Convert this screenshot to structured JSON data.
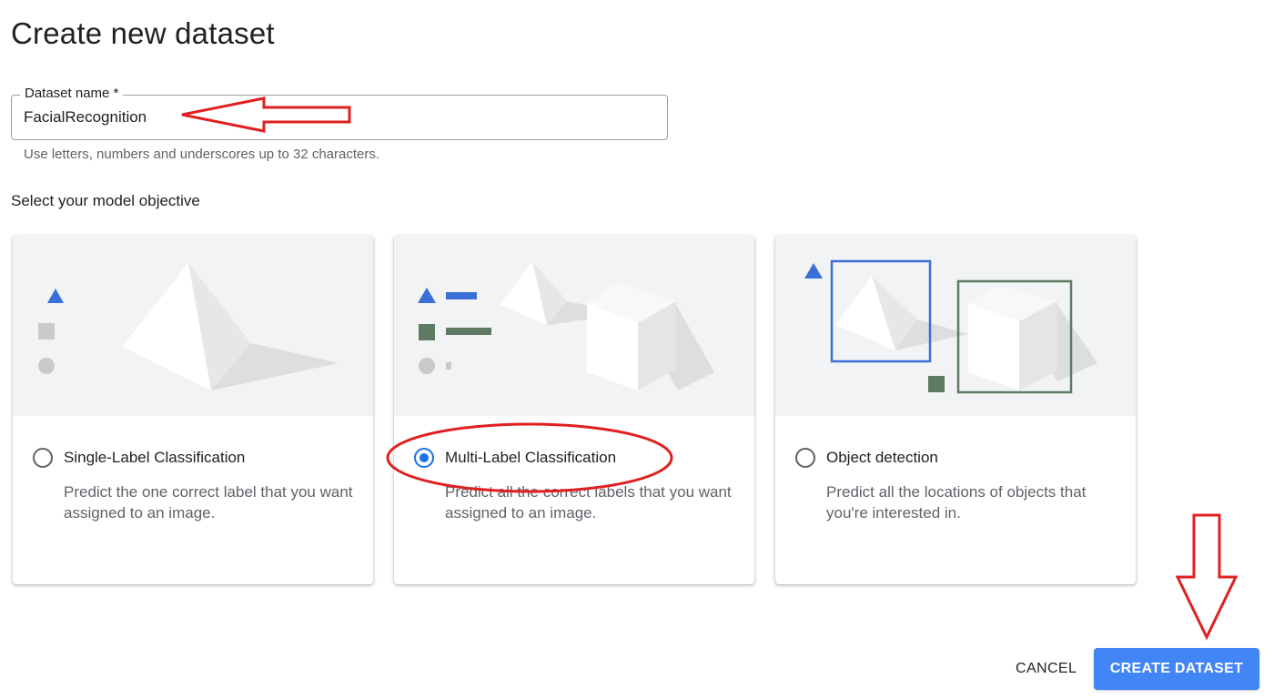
{
  "page_title": "Create new dataset",
  "dataset_name": {
    "label": "Dataset name *",
    "value": "FacialRecognition",
    "hint": "Use letters, numbers and underscores up to 32 characters."
  },
  "objective": {
    "heading": "Select your model objective",
    "cards": [
      {
        "title": "Single-Label Classification",
        "description": "Predict the one correct label that you want assigned to an image.",
        "selected": false
      },
      {
        "title": "Multi-Label Classification",
        "description": "Predict all the correct labels that you want assigned to an image.",
        "selected": true
      },
      {
        "title": "Object detection",
        "description": "Predict all the locations of objects that you're interested in.",
        "selected": false
      }
    ]
  },
  "actions": {
    "cancel_label": "CANCEL",
    "create_label": "CREATE DATASET"
  },
  "colors": {
    "accent_blue": "#1a73e8",
    "button_blue": "#4285f4",
    "shape_blue": "#3b6fd8",
    "shape_green": "#5f7a63",
    "annotation_red": "#e02020"
  },
  "icons": [
    "triangle-icon",
    "square-icon",
    "circle-icon",
    "pyramid-illustration",
    "cube-illustration",
    "radio-icon"
  ]
}
